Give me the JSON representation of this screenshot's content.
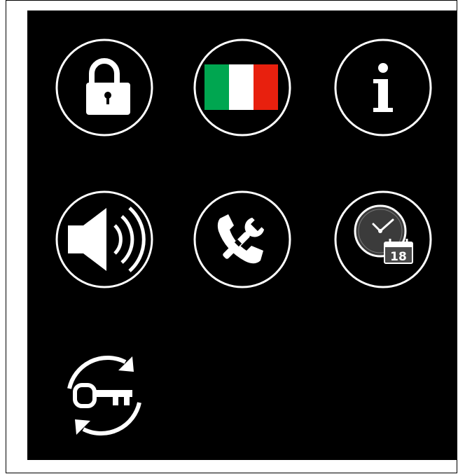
{
  "screen": {
    "background": "#000000",
    "icon_stroke": "#ffffff"
  },
  "menu": {
    "items": [
      {
        "id": "lock",
        "icon": "padlock-icon"
      },
      {
        "id": "language",
        "icon": "italian-flag-icon",
        "flag_colors": [
          "#00a650",
          "#ffffff",
          "#e8200e"
        ]
      },
      {
        "id": "info",
        "icon": "info-icon"
      },
      {
        "id": "volume",
        "icon": "speaker-volume-icon"
      },
      {
        "id": "service",
        "icon": "phone-wrench-icon"
      },
      {
        "id": "datetime",
        "icon": "clock-calendar-icon",
        "calendar_day": "18"
      },
      {
        "id": "reset-code",
        "icon": "key-refresh-icon"
      }
    ]
  }
}
